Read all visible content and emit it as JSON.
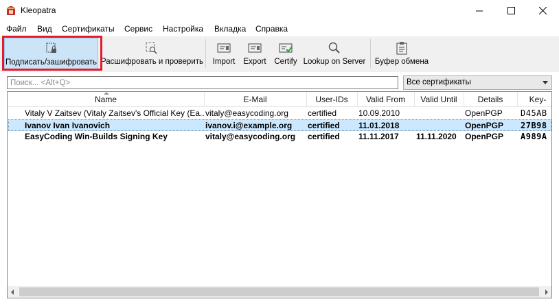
{
  "window": {
    "title": "Kleopatra"
  },
  "menu": [
    "Файл",
    "Вид",
    "Сертификаты",
    "Сервис",
    "Настройка",
    "Вкладка",
    "Справка"
  ],
  "toolbar": {
    "sign_encrypt": "Подписать/зашифровать",
    "decrypt_verify": "Расшифровать и проверить",
    "import": "Import",
    "export": "Export",
    "certify": "Certify",
    "lookup": "Lookup on Server",
    "clipboard": "Буфер обмена"
  },
  "search": {
    "placeholder": "Поиск... <Alt+Q>"
  },
  "filter": {
    "selected": "Все сертификаты"
  },
  "columns": [
    "Name",
    "E-Mail",
    "User-IDs",
    "Valid From",
    "Valid Until",
    "Details",
    "Key-"
  ],
  "rows": [
    {
      "name": "Vitaly V Zaitsev (Vitaly Zaitsev's Official Key (Ea...",
      "email": "vitaly@easycoding.org",
      "uids": "certified",
      "from": "10.09.2010",
      "until": "",
      "details": "OpenPGP",
      "key": "D45AB"
    },
    {
      "name": "Ivanov Ivan Ivanovich",
      "email": "ivanov.i@example.org",
      "uids": "certified",
      "from": "11.01.2018",
      "until": "",
      "details": "OpenPGP",
      "key": "27B98"
    },
    {
      "name": "EasyCoding Win-Builds Signing Key",
      "email": "vitaly@easycoding.org",
      "uids": "certified",
      "from": "11.11.2017",
      "until": "11.11.2020",
      "details": "OpenPGP",
      "key": "A989A"
    }
  ],
  "colors": {
    "highlight": "#e51a2a",
    "selection": "#cce8ff",
    "accent": "#cce4f7"
  }
}
